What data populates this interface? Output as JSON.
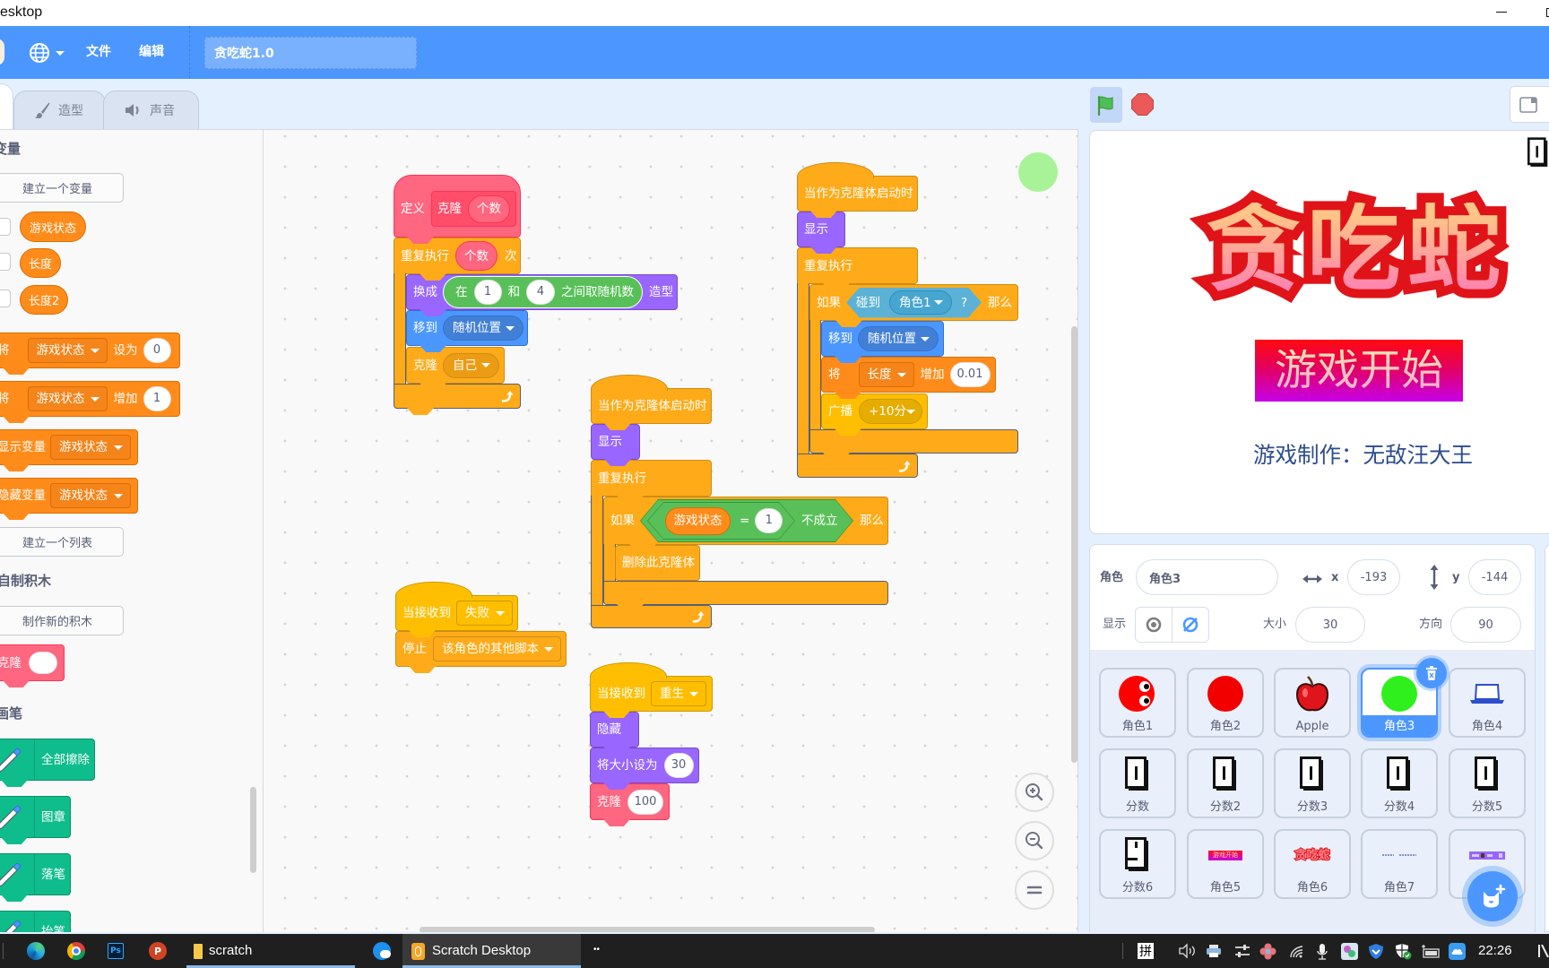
{
  "theme": {
    "menu_bar": "#4c97ff",
    "accent": "#4c97ff",
    "motion": "#4c97ff",
    "looks": "#9966ff",
    "control": "#ffab19",
    "events": "#ffbf00",
    "sensing": "#5cb1d6",
    "operators": "#59c059",
    "variables": "#ff8c1a",
    "my_blocks": "#ff6680",
    "pen": "#0fbd8c",
    "stop_red": "#ec5959",
    "flag_green": "#4cbf56"
  },
  "window": {
    "title": "esktop"
  },
  "menubar": {
    "language_icon": "globe-icon",
    "file": "文件",
    "edit": "编辑",
    "project_title": "贪吃蛇1.0"
  },
  "editor_tabs": {
    "costumes": "造型",
    "sounds": "声音"
  },
  "controls": {
    "green_flag_icon": "green-flag-icon",
    "stop_icon": "stop-icon",
    "stage_size_icon": "small-stage-icon"
  },
  "palette": {
    "variables_heading": "变量",
    "make_variable": "建立一个变量",
    "variables": [
      "游戏状态",
      "长度",
      "长度2"
    ],
    "set_block": {
      "label": "将",
      "variable": "游戏状态",
      "verb": "设为",
      "value": "0"
    },
    "change_block": {
      "label": "将",
      "variable": "游戏状态",
      "verb": "增加",
      "value": "1"
    },
    "show_variable_block": {
      "label": "显示变量",
      "variable": "游戏状态"
    },
    "hide_variable_block": {
      "label": "隐藏变量",
      "variable": "游戏状态"
    },
    "make_list": "建立一个列表",
    "my_blocks_heading": "自制积木",
    "make_block": "制作新的积木",
    "custom_block": {
      "label": "克隆"
    },
    "pen_heading": "画笔",
    "pen_blocks": [
      "全部擦除",
      "图章",
      "落笔",
      "抬笔"
    ]
  },
  "scripts": {
    "define_clone": {
      "define_label": "定义",
      "name": "克隆",
      "param": "个数",
      "repeat": {
        "label": "重复执行",
        "count": "个数",
        "suffix": "次"
      },
      "switch_costume": {
        "label": "换成",
        "suffix": "造型",
        "random": {
          "prefix": "在",
          "from": "1",
          "and": "和",
          "to": "4",
          "suffix": "之间取随机数"
        }
      },
      "go_to": {
        "label": "移到",
        "target": "随机位置"
      },
      "create_clone": {
        "label": "克隆",
        "target": "自己"
      }
    },
    "clone_touch": {
      "hat": "当作为克隆体启动时",
      "show": "显示",
      "forever": "重复执行",
      "if_label": "如果",
      "then_label": "那么",
      "touching": {
        "label": "碰到",
        "target": "角色1",
        "suffix": "?"
      },
      "go_to": {
        "label": "移到",
        "target": "随机位置"
      },
      "change_var": {
        "label": "将",
        "variable": "长度",
        "verb": "增加",
        "value": "0.01"
      },
      "broadcast": {
        "label": "广播",
        "message": "+10分"
      }
    },
    "clone_state": {
      "hat": "当作为克隆体启动时",
      "show": "显示",
      "forever": "重复执行",
      "if_label": "如果",
      "then_label": "那么",
      "not_label": "不成立",
      "equals": {
        "variable": "游戏状态",
        "op": "=",
        "value": "1"
      },
      "delete_clone": "删除此克隆体"
    },
    "on_fail": {
      "hat": "当接收到",
      "message": "失败",
      "stop": {
        "label": "停止",
        "option": "该角色的其他脚本"
      }
    },
    "on_respawn": {
      "hat": "当接收到",
      "message": "重生",
      "hide": "隐藏",
      "set_size": {
        "label": "将大小设为",
        "value": "30"
      },
      "clone": {
        "label": "克隆",
        "value": "100"
      }
    }
  },
  "workspace": {
    "zoom_in_icon": "zoom-in-icon",
    "zoom_out_icon": "zoom-out-icon",
    "zoom_reset_icon": "zoom-reset-icon"
  },
  "stage": {
    "title": "贪吃蛇",
    "start_button": "游戏开始",
    "credit": "游戏制作：无敌汪大王"
  },
  "sprite_info": {
    "sprite_label": "角色",
    "sprite_name": "角色3",
    "x_label": "x",
    "x": "-193",
    "y_label": "y",
    "y": "-144",
    "show_label": "显示",
    "visible": false,
    "size_label": "大小",
    "size": "30",
    "direction_label": "方向",
    "direction": "90"
  },
  "sprites": {
    "selected": "角色3",
    "items": [
      {
        "name": "角色1",
        "thumbnail": "red-ball-with-eyes"
      },
      {
        "name": "角色2",
        "thumbnail": "red-ball"
      },
      {
        "name": "Apple",
        "thumbnail": "apple"
      },
      {
        "name": "角色3",
        "thumbnail": "green-ball"
      },
      {
        "name": "角色4",
        "thumbnail": "laptop"
      },
      {
        "name": "分数",
        "thumbnail": "score-digit"
      },
      {
        "name": "分数2",
        "thumbnail": "score-digit"
      },
      {
        "name": "分数3",
        "thumbnail": "score-digit"
      },
      {
        "name": "分数4",
        "thumbnail": "score-digit"
      },
      {
        "name": "分数5",
        "thumbnail": "score-digit"
      },
      {
        "name": "分数6",
        "thumbnail": "score-digit"
      },
      {
        "name": "角色5",
        "thumbnail": "start-button-image",
        "thumb_text": "游戏开始"
      },
      {
        "name": "角色6",
        "thumbnail": "title-image",
        "thumb_text": "贪吃蛇"
      },
      {
        "name": "角色7",
        "thumbnail": "credit-text-image"
      },
      {
        "thumbnail": "purple-bar-image"
      }
    ]
  },
  "taskbar": {
    "pinned": [
      "edge-icon",
      "chrome-icon",
      "photoshop-icon",
      "powerpoint-icon"
    ],
    "photoshop_text": "Ps",
    "powerpoint_text": "P",
    "items": [
      {
        "label": "scratch",
        "icon": "folder-icon"
      },
      {
        "label": "Scratch Desktop",
        "icon": "scratch-icon",
        "active": true
      }
    ],
    "overflow": "••",
    "ime": "拼",
    "clock": "22:26"
  }
}
